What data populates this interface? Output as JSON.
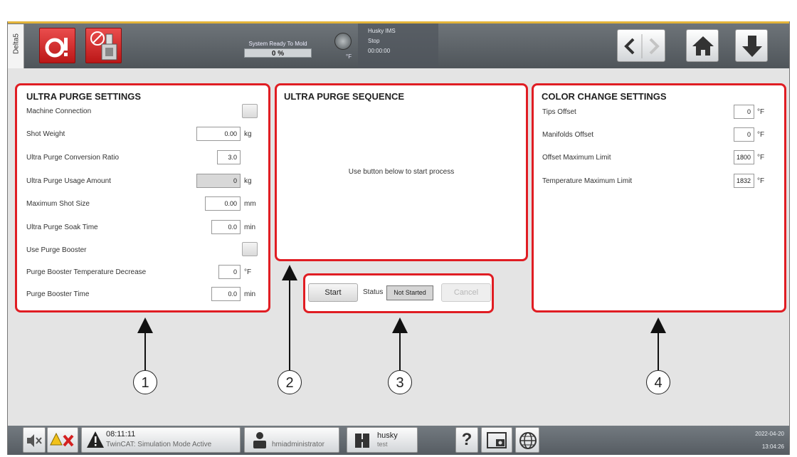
{
  "header": {
    "side_tab": "Delta5",
    "machine_status": "System Ready To Mold",
    "progress": "0 %",
    "progress_value": 0,
    "temp_unit": "°F",
    "ims_title": "Husky IMS",
    "ims_state": "Stop",
    "ims_time": "00:00:00"
  },
  "panel1": {
    "title": "ULTRA PURGE SETTINGS",
    "rows": [
      {
        "label": "Machine Connection"
      },
      {
        "label": "Shot Weight",
        "value": "0.00",
        "unit": "kg"
      },
      {
        "label": "Ultra Purge Conversion Ratio",
        "value": "3.0"
      },
      {
        "label": "Ultra Purge Usage Amount",
        "value": "0",
        "unit": "kg"
      },
      {
        "label": "Maximum Shot Size",
        "value": "0.00",
        "unit": "mm"
      },
      {
        "label": "Ultra Purge Soak Time",
        "value": "0.0",
        "unit": "min"
      },
      {
        "label": "Use Purge Booster"
      },
      {
        "label": "Purge Booster Temperature Decrease",
        "value": "0",
        "unit": "°F"
      },
      {
        "label": "Purge Booster Time",
        "value": "0.0",
        "unit": "min"
      }
    ]
  },
  "panel2": {
    "title": "ULTRA PURGE SEQUENCE",
    "message": "Use button below to start process"
  },
  "panel3": {
    "start": "Start",
    "status_label": "Status",
    "status_value": "Not Started",
    "cancel": "Cancel"
  },
  "panel4": {
    "title": "COLOR CHANGE SETTINGS",
    "rows": [
      {
        "label": "Tips Offset",
        "value": "0",
        "unit": "°F"
      },
      {
        "label": "Manifolds Offset",
        "value": "0",
        "unit": "°F"
      },
      {
        "label": "Offset Maximum Limit",
        "value": "1800",
        "unit": "°F"
      },
      {
        "label": "Temperature Maximum Limit",
        "value": "1832",
        "unit": "°F"
      }
    ]
  },
  "callouts": [
    "1",
    "2",
    "3",
    "4"
  ],
  "footer": {
    "alarm_time": "08:11:11",
    "alarm_text": "TwinCAT: Simulation Mode Active",
    "user": "hmiadministrator",
    "profile_name": "husky",
    "profile_sub": "test",
    "help": "?",
    "date": "2022-04-20",
    "time": "13:04:26"
  },
  "colors": {
    "highlight": "#e01d23",
    "accent_bar": "#e3b43a",
    "alarm_button": "#d42020"
  }
}
